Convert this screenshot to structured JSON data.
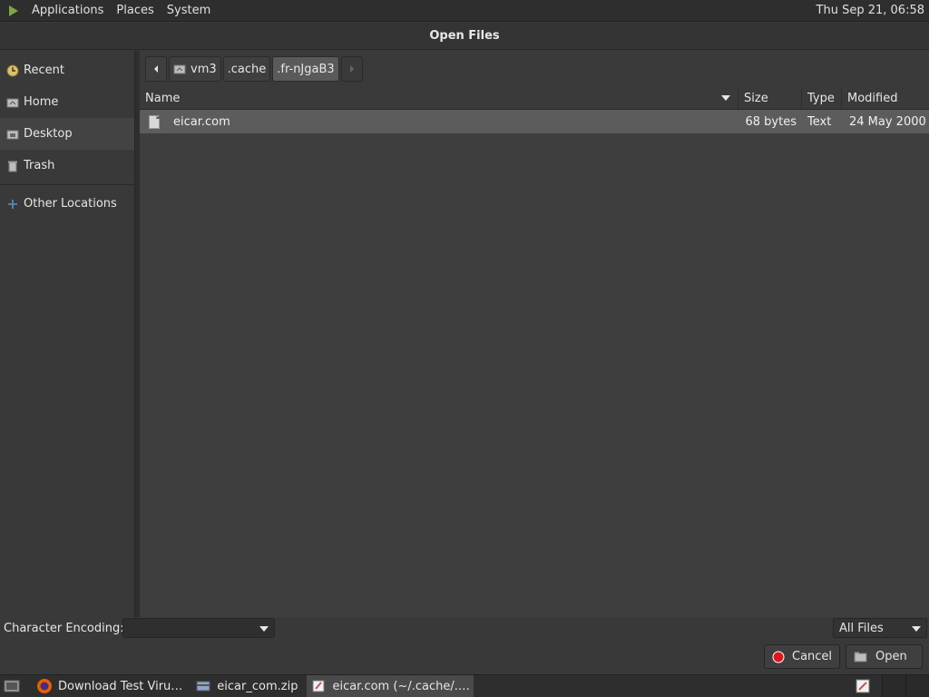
{
  "top_panel": {
    "menus": [
      "Applications",
      "Places",
      "System"
    ],
    "clock": "Thu Sep 21, 06:58"
  },
  "dialog": {
    "title": "Open Files"
  },
  "sidebar": {
    "items": [
      {
        "label": "Recent",
        "icon": "clock-icon"
      },
      {
        "label": "Home",
        "icon": "home-folder-icon"
      },
      {
        "label": "Desktop",
        "icon": "desktop-folder-icon"
      },
      {
        "label": "Trash",
        "icon": "trash-icon"
      },
      {
        "label": "Other Locations",
        "icon": "plus-icon"
      }
    ]
  },
  "pathbar": {
    "crumbs": [
      "vm3",
      ".cache",
      ".fr-nJgaB3"
    ]
  },
  "filelist": {
    "columns": {
      "name": "Name",
      "size": "Size",
      "type": "Type",
      "modified": "Modified"
    },
    "rows": [
      {
        "name": "eicar.com",
        "size": "68 bytes",
        "type": "Text",
        "modified": "24 May 2000"
      }
    ]
  },
  "bottom": {
    "encoding_label": "Character Encoding:",
    "encoding_value": "",
    "filter_value": "All Files",
    "cancel_label": "Cancel",
    "open_label": "Open"
  },
  "taskbar": {
    "tasks": [
      {
        "label": "Download Test Viru…",
        "icon": "firefox-icon"
      },
      {
        "label": "eicar_com.zip",
        "icon": "archive-manager-icon"
      },
      {
        "label": "eicar.com (~/.cache/.…",
        "icon": "text-editor-icon"
      }
    ]
  },
  "colors": {
    "accent_red": "#e0141e",
    "selection": "#5c5c5c",
    "panel": "#2e2e2e"
  }
}
